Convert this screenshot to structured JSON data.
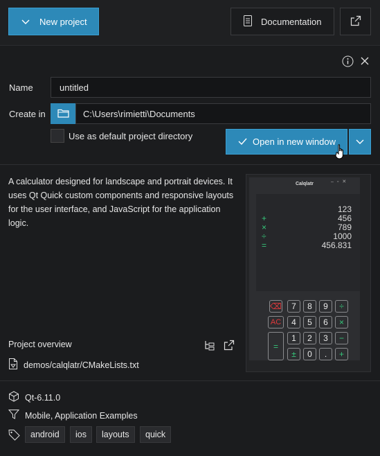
{
  "toolbar": {
    "new_project": "New project",
    "documentation": "Documentation"
  },
  "form": {
    "name_label": "Name",
    "name_value": "untitled",
    "create_in_label": "Create in",
    "create_in_value": "C:\\Users\\rimietti\\Documents",
    "default_dir_label": "Use as default project directory",
    "open_button": "Open in new window"
  },
  "example": {
    "description": "A calculator designed for landscape and portrait devices. It uses Qt Quick custom components and responsive layouts for the user interface, and JavaScript for the application logic.",
    "overview_label": "Project overview",
    "file_path": "demos/calqlatr/CMakeLists.txt",
    "qt_version": "Qt-6.11.0",
    "categories": "Mobile,  Application Examples",
    "tags": [
      "android",
      "ios",
      "layouts",
      "quick"
    ]
  },
  "preview": {
    "title": "Calqlatr",
    "rows": [
      {
        "op": "",
        "value": "123"
      },
      {
        "op": "+",
        "value": "456"
      },
      {
        "op": "×",
        "value": "789"
      },
      {
        "op": "÷",
        "value": "1000"
      },
      {
        "op": "=",
        "value": "456.831"
      }
    ],
    "keys": {
      "row1": [
        "⌫",
        "7",
        "8",
        "9",
        "÷"
      ],
      "row2": [
        "AC",
        "4",
        "5",
        "6",
        "×"
      ],
      "row3": [
        "1",
        "2",
        "3",
        "−"
      ],
      "row4": [
        "±",
        "0",
        ".",
        "+"
      ],
      "equals": "="
    }
  },
  "colors": {
    "accent": "#2d89b8",
    "background": "#1b1c1e",
    "calc_green": "#35c77a",
    "calc_red": "#e0393c"
  }
}
